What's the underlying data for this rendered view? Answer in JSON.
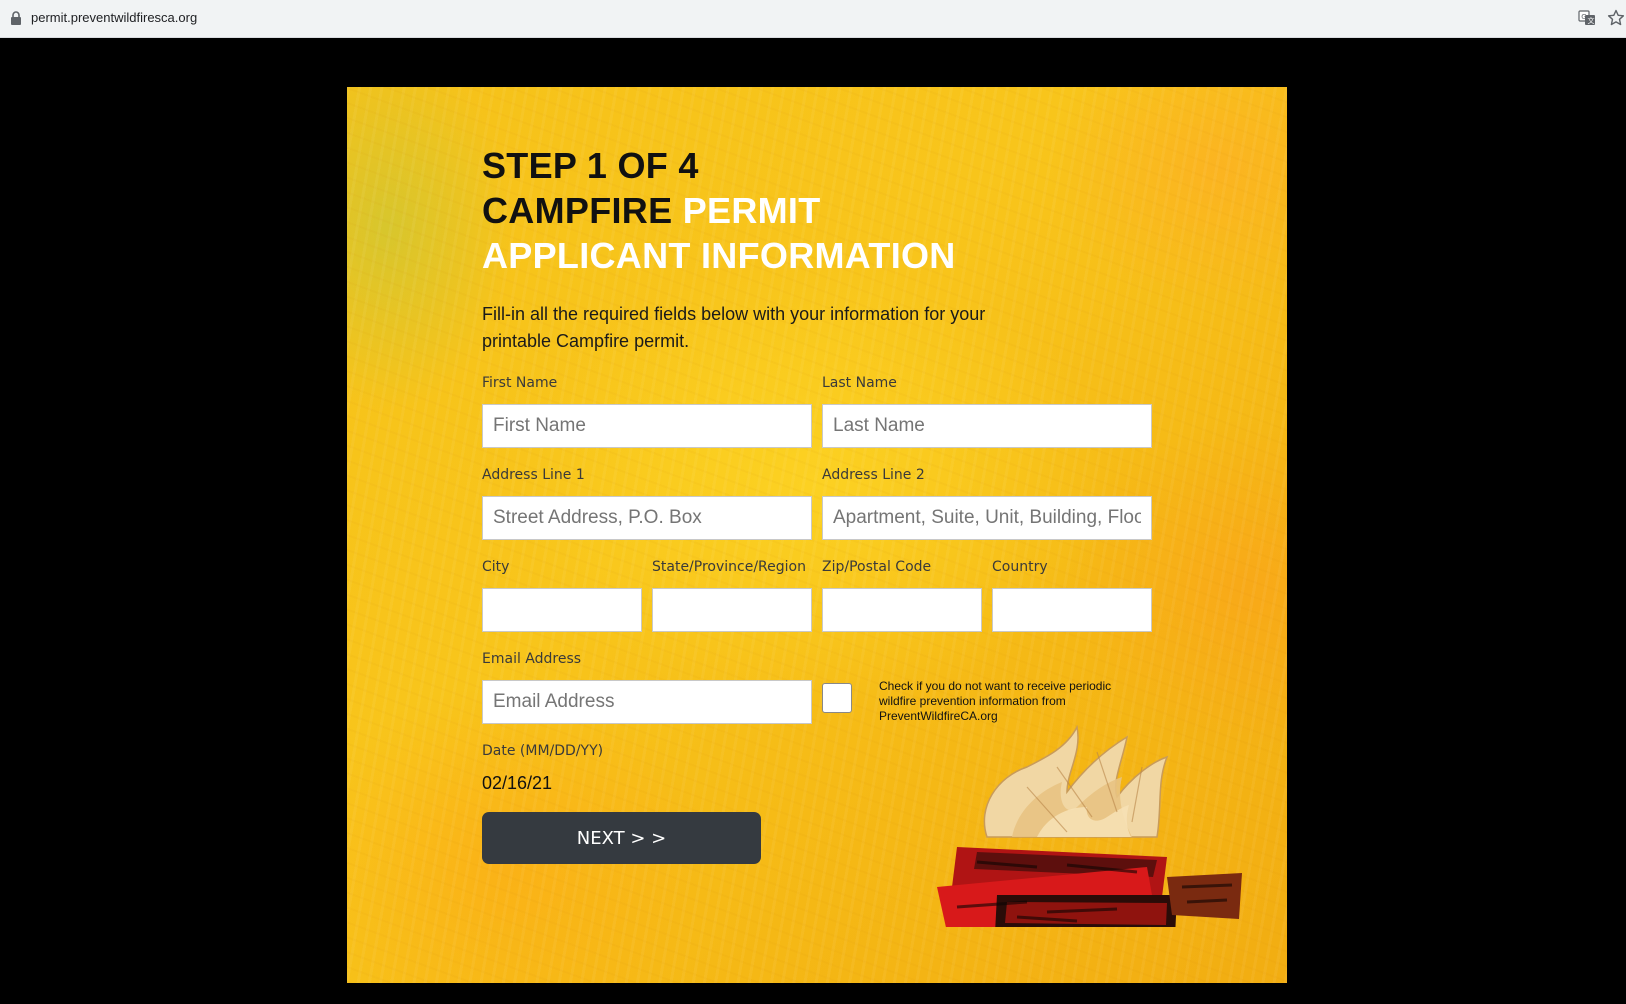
{
  "browser": {
    "url": "permit.preventwildfiresca.org",
    "icons": [
      "lock-icon",
      "translate-icon",
      "star-icon"
    ]
  },
  "form": {
    "heading": {
      "step": "STEP 1 OF 4",
      "title_dark": "CAMPFIRE",
      "title_light": "PERMIT",
      "subtitle": "APPLICANT INFORMATION"
    },
    "intro": "Fill-in all the required fields below with your information for your printable Campfire permit.",
    "fields": {
      "first_name": {
        "label": "First Name",
        "placeholder": "First Name",
        "value": ""
      },
      "last_name": {
        "label": "Last Name",
        "placeholder": "Last Name",
        "value": ""
      },
      "address1": {
        "label": "Address Line 1",
        "placeholder": "Street Address, P.O. Box",
        "value": ""
      },
      "address2": {
        "label": "Address Line 2",
        "placeholder": "Apartment, Suite, Unit, Building, Floor",
        "value": ""
      },
      "city": {
        "label": "City",
        "value": ""
      },
      "state": {
        "label": "State/Province/Region",
        "value": ""
      },
      "zip": {
        "label": "Zip/Postal Code",
        "value": ""
      },
      "country": {
        "label": "Country",
        "value": ""
      },
      "email": {
        "label": "Email Address",
        "placeholder": "Email Address",
        "value": ""
      }
    },
    "optout": {
      "checked": false,
      "text": "Check if you do not want to receive periodic wildfire prevention information from PreventWildfireCA.org"
    },
    "date": {
      "label": "Date (MM/DD/YY)",
      "value": "02/16/21"
    },
    "next_button": "NEXT > >"
  },
  "colors": {
    "panel_yellow": "#f6c21a",
    "button_dark": "#353a40",
    "heading_dark": "#111111",
    "heading_light": "#ffffff"
  }
}
